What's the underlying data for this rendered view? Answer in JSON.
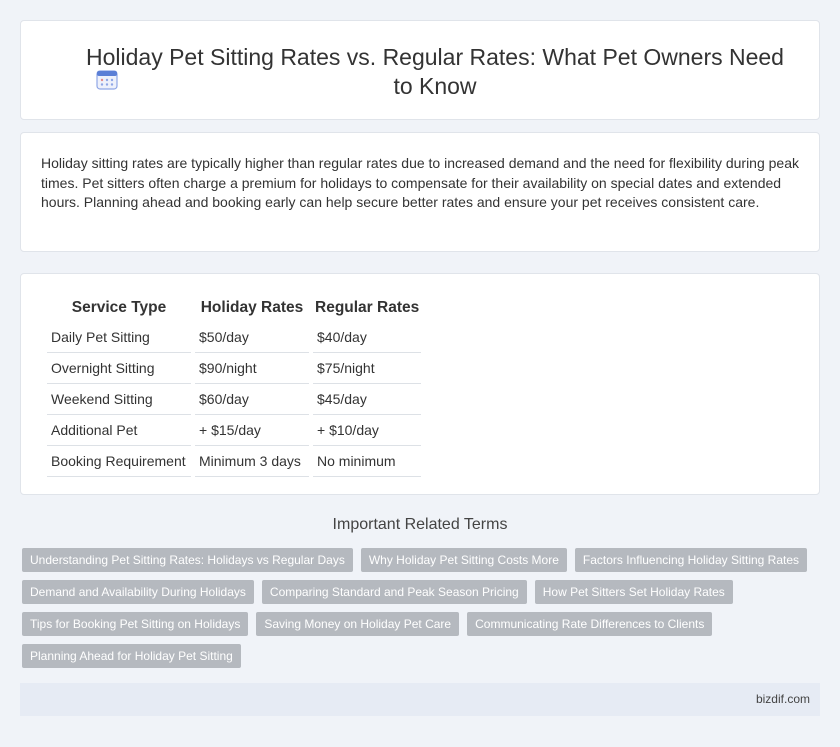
{
  "header": {
    "title": "Holiday Pet Sitting Rates vs. Regular Rates: What Pet Owners Need to Know",
    "icon": "calendar-icon",
    "accent": "#5b7fd6"
  },
  "intro": {
    "text": "Holiday sitting rates are typically higher than regular rates due to increased demand and the need for flexibility during peak times. Pet sitters often charge a premium for holidays to compensate for their availability on special dates and extended hours. Planning ahead and booking early can help secure better rates and ensure your pet receives consistent care."
  },
  "table": {
    "headers": [
      "Service Type",
      "Holiday Rates",
      "Regular Rates"
    ],
    "rows": [
      [
        "Daily Pet Sitting",
        "$50/day",
        "$40/day"
      ],
      [
        "Overnight Sitting",
        "$90/night",
        "$75/night"
      ],
      [
        "Weekend Sitting",
        "$60/day",
        "$45/day"
      ],
      [
        "Additional Pet",
        "+ $15/day",
        "+ $10/day"
      ],
      [
        "Booking Requirement",
        "Minimum 3 days",
        "No minimum"
      ]
    ]
  },
  "related": {
    "title": "Important Related Terms",
    "tags": [
      "Understanding Pet Sitting Rates: Holidays vs Regular Days",
      "Why Holiday Pet Sitting Costs More",
      "Factors Influencing Holiday Sitting Rates",
      "Demand and Availability During Holidays",
      "Comparing Standard and Peak Season Pricing",
      "How Pet Sitters Set Holiday Rates",
      "Tips for Booking Pet Sitting on Holidays",
      "Saving Money on Holiday Pet Care",
      "Communicating Rate Differences to Clients",
      "Planning Ahead for Holiday Pet Sitting"
    ]
  },
  "footer": {
    "brand": "bizdif.com"
  }
}
